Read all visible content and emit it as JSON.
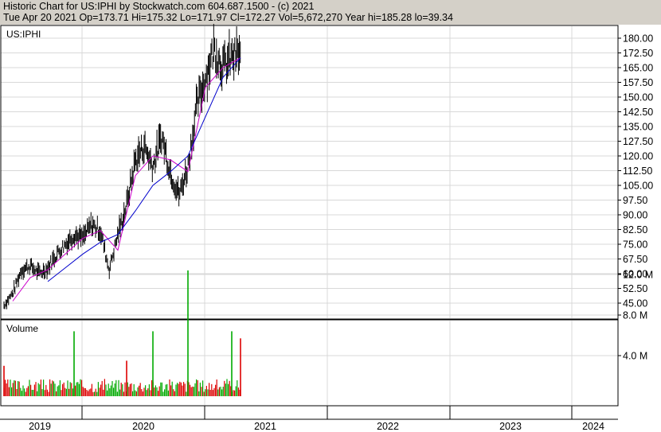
{
  "header": {
    "title": "Historic Chart for US:IPHI by Stockwatch.com 604.687.1500 - (c) 2021",
    "quote_line": "Tue Apr 20 2021   Op=173.71  Hi=175.32  Lo=171.97  Cl=172.27  Vol=5,672,270  Year hi=185.28  lo=39.34"
  },
  "chart_data": [
    {
      "type": "line",
      "panel": "price",
      "label": "US:IPHI",
      "ylim": [
        39.34,
        185.28
      ],
      "y_tick_labels": [
        "180.00",
        "172.50",
        "165.00",
        "157.50",
        "150.00",
        "142.50",
        "135.00",
        "127.50",
        "120.00",
        "112.50",
        "105.00",
        "97.50",
        "90.00",
        "82.50",
        "75.00",
        "67.50",
        "60.00",
        "52.50",
        "45.00"
      ],
      "y_ticks": [
        180,
        172.5,
        165,
        157.5,
        150,
        142.5,
        135,
        127.5,
        120,
        112.5,
        105,
        97.5,
        90,
        82.5,
        75,
        67.5,
        60,
        52.5,
        45
      ],
      "grid": true,
      "series": [
        {
          "color": "#000000",
          "x": [
            "2019-01",
            "2019-02",
            "2019-03",
            "2019-04",
            "2019-05",
            "2019-06",
            "2019-07",
            "2019-08",
            "2019-09",
            "2019-10",
            "2019-11",
            "2019-12",
            "2020-01",
            "2020-02",
            "2020-03",
            "2020-04",
            "2020-05",
            "2020-06",
            "2020-07",
            "2020-08",
            "2020-09",
            "2020-10",
            "2020-11",
            "2020-12",
            "2021-01",
            "2021-02",
            "2021-03",
            "2021-04"
          ],
          "values": [
            44,
            50,
            62,
            64,
            60,
            63,
            70,
            75,
            80,
            78,
            85,
            82,
            62,
            80,
            95,
            118,
            125,
            115,
            130,
            112,
            100,
            115,
            145,
            160,
            175,
            165,
            170,
            172
          ]
        },
        {
          "color": "#cc00cc",
          "x": [
            "2019-02",
            "2019-04",
            "2019-06",
            "2019-08",
            "2019-10",
            "2019-12",
            "2020-02",
            "2020-04",
            "2020-06",
            "2020-08",
            "2020-10",
            "2020-12",
            "2021-02",
            "2021-04"
          ],
          "values": [
            46,
            58,
            62,
            70,
            78,
            82,
            72,
            110,
            120,
            118,
            112,
            155,
            165,
            170
          ]
        },
        {
          "color": "#0000cc",
          "x": [
            "2019-06",
            "2019-08",
            "2019-10",
            "2019-12",
            "2020-02",
            "2020-04",
            "2020-06",
            "2020-08",
            "2020-10",
            "2020-12",
            "2021-02",
            "2021-04"
          ],
          "values": [
            56,
            63,
            70,
            76,
            80,
            92,
            105,
            112,
            120,
            140,
            160,
            170
          ]
        }
      ]
    },
    {
      "type": "bar",
      "panel": "volume",
      "label": "Volume",
      "y_tick_labels": [
        "12.0 M",
        "8.0 M",
        "4.0 M"
      ],
      "y_ticks": [
        12,
        8,
        4
      ],
      "ylim": [
        0,
        15
      ],
      "x_tick_labels": [
        "2019",
        "2020",
        "2021",
        "2022",
        "2023",
        "2024"
      ],
      "spikes": [
        {
          "x": "2019-01",
          "value": 3.0,
          "color": "#dd0000"
        },
        {
          "x": "2019-09",
          "value": 6.4,
          "color": "#00aa00"
        },
        {
          "x": "2020-03",
          "value": 3.5,
          "color": "#dd0000"
        },
        {
          "x": "2020-06",
          "value": 6.4,
          "color": "#00aa00"
        },
        {
          "x": "2020-10",
          "value": 12.4,
          "color": "#00aa00"
        },
        {
          "x": "2021-03",
          "value": 6.4,
          "color": "#00aa00"
        },
        {
          "x": "2021-04",
          "value": 5.7,
          "color": "#dd0000"
        }
      ]
    }
  ]
}
